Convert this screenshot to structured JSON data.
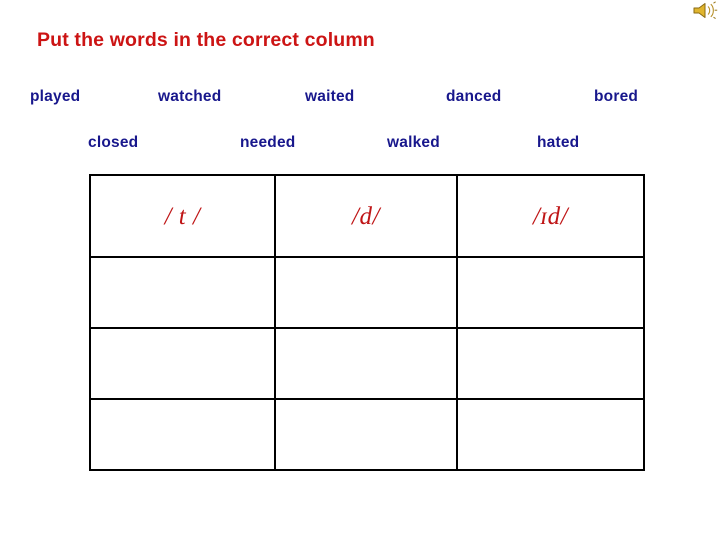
{
  "meta": {
    "background_color": "#FFFFFF",
    "accent_red": "#CC1414",
    "phoneme_red": "#BF1516",
    "word_navy": "#18178C",
    "border_black": "#000000"
  },
  "media": {
    "speaker_icon_name": "speaker-sound-icon",
    "speaker_icon_color": "#D4A521"
  },
  "header": {
    "title": "Put the words in the correct column"
  },
  "word_bank": {
    "row1": [
      {
        "id": "played",
        "label": "played"
      },
      {
        "id": "watched",
        "label": "watched"
      },
      {
        "id": "waited",
        "label": "waited"
      },
      {
        "id": "danced",
        "label": "danced"
      },
      {
        "id": "bored",
        "label": "bored"
      }
    ],
    "row2": [
      {
        "id": "closed",
        "label": "closed"
      },
      {
        "id": "needed",
        "label": "needed"
      },
      {
        "id": "walked",
        "label": "walked"
      },
      {
        "id": "hated",
        "label": "hated"
      }
    ]
  },
  "table": {
    "columns": 3,
    "rows": 4,
    "headers": [
      {
        "id": "t",
        "label": "/ t /"
      },
      {
        "id": "d",
        "label": "/d/"
      },
      {
        "id": "id",
        "label": "/ɪd/"
      }
    ],
    "body": [
      [
        "",
        "",
        ""
      ],
      [
        "",
        "",
        ""
      ],
      [
        "",
        "",
        ""
      ]
    ]
  }
}
